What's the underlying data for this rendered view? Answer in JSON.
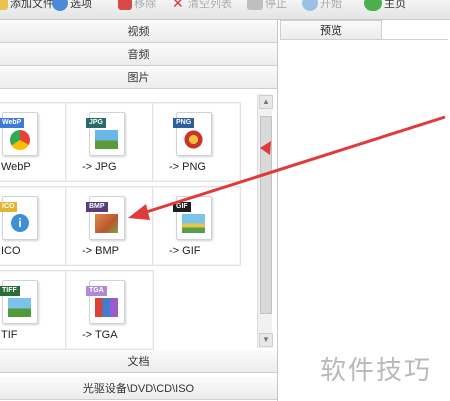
{
  "toolbar": {
    "items": [
      {
        "label": "添加文件",
        "icon": "add-folder-icon"
      },
      {
        "label": "选项",
        "icon": "options-icon"
      },
      {
        "label": "移除",
        "icon": "remove-icon"
      },
      {
        "label": "清空列表",
        "icon": "clear-icon"
      },
      {
        "label": "停止",
        "icon": "stop-icon"
      },
      {
        "label": "开始",
        "icon": "start-icon"
      },
      {
        "label": "主页",
        "icon": "home-icon"
      }
    ]
  },
  "categories": {
    "video": "视频",
    "audio": "音频",
    "image": "图片",
    "document": "文档",
    "optical": "光驱设备\\DVD\\CD\\ISO"
  },
  "formats": [
    {
      "label": "WebP",
      "tag": "WebP",
      "tag_color": "#3e7bd6"
    },
    {
      "label": "-> JPG",
      "tag": "JPG",
      "tag_color": "#2a6a6a"
    },
    {
      "label": "-> PNG",
      "tag": "PNG",
      "tag_color": "#2f5f9e"
    },
    {
      "label": "ICO",
      "tag": "ICO",
      "tag_color": "#e1b530"
    },
    {
      "label": "-> BMP",
      "tag": "BMP",
      "tag_color": "#5a3b78"
    },
    {
      "label": "-> GIF",
      "tag": "GIF",
      "tag_color": "#1e1e1e"
    },
    {
      "label": "TIF",
      "tag": "TIFF",
      "tag_color": "#2d6b3a"
    },
    {
      "label": "-> TGA",
      "tag": "TGA",
      "tag_color": "#b08ad2"
    }
  ],
  "preview": {
    "tab": "预览"
  },
  "watermark": "软件技巧",
  "colors": {
    "annotation": "#e03a3a"
  }
}
